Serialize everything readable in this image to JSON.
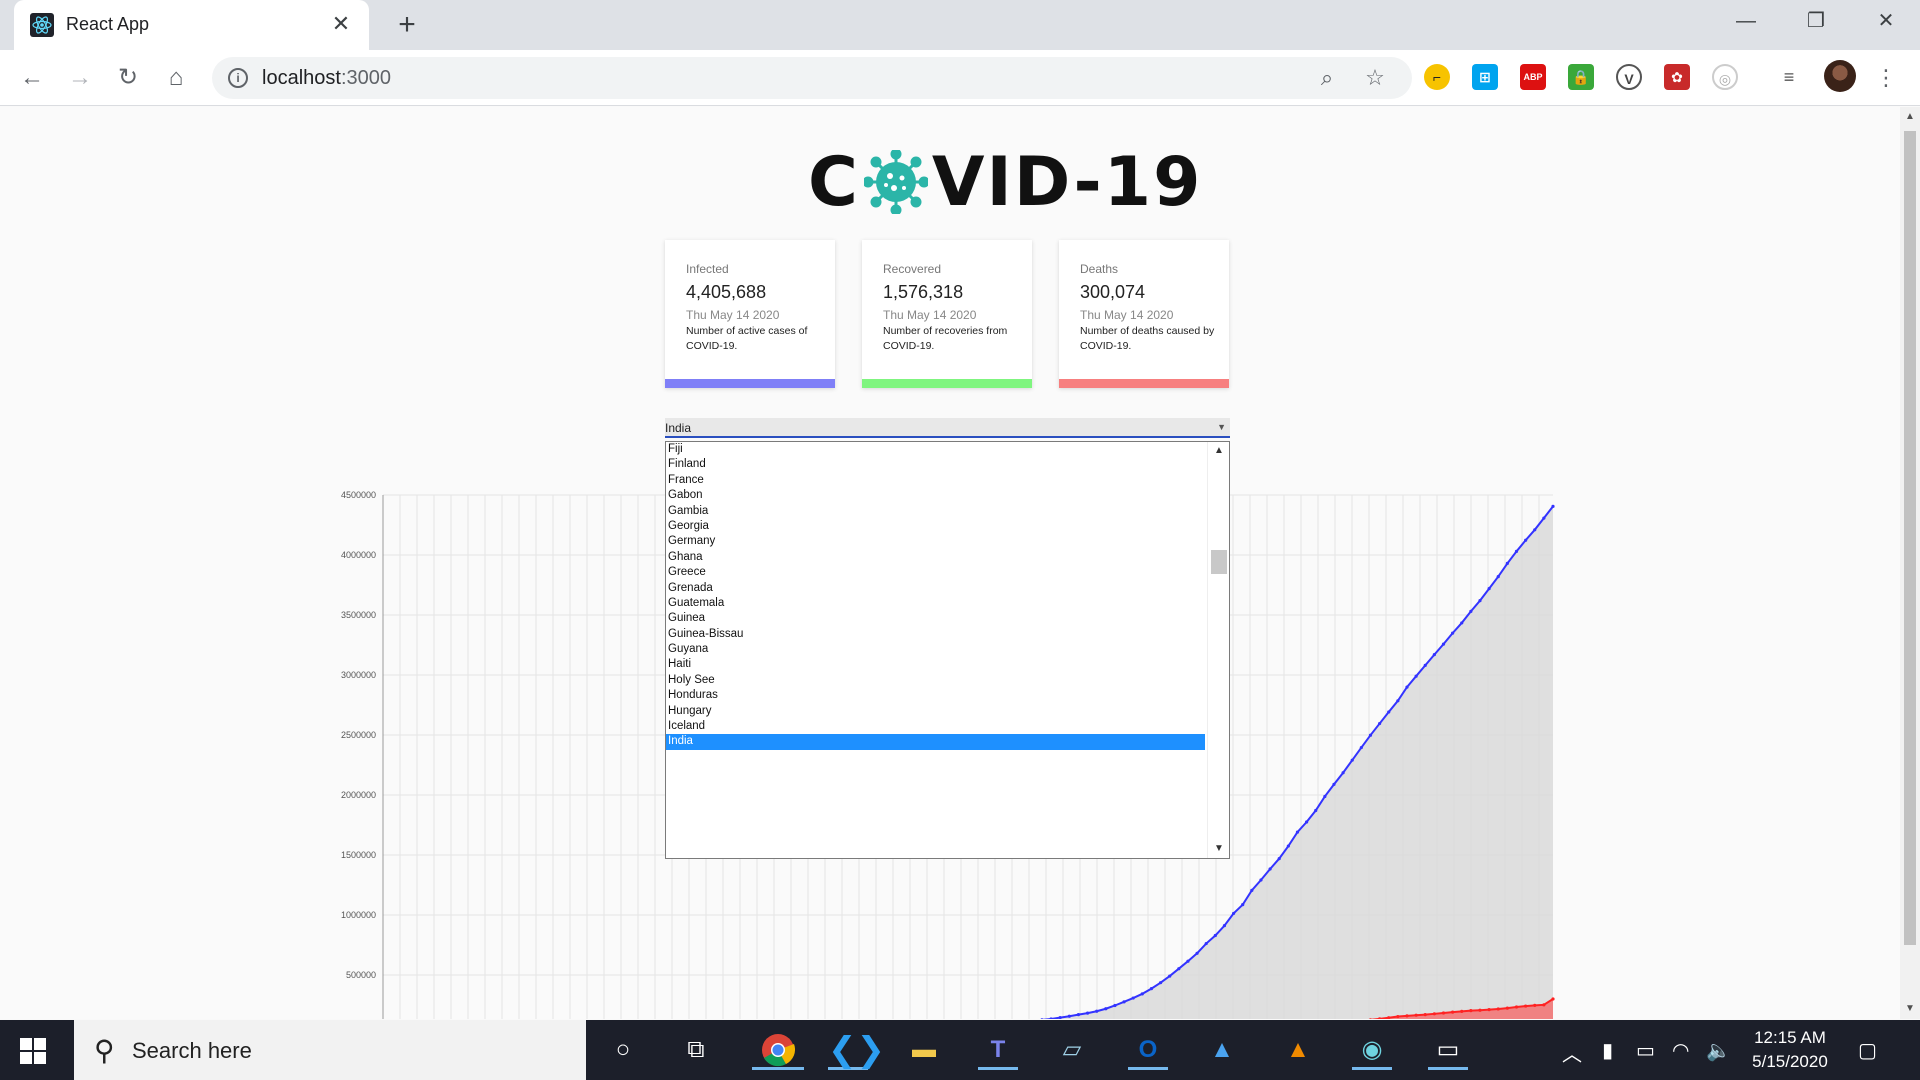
{
  "browser": {
    "tab_title": "React App",
    "url_host": "localhost",
    "url_port": ":3000",
    "tab_close": "✕",
    "new_tab": "+"
  },
  "page": {
    "logo_left": "C",
    "logo_right": "VID-19",
    "cards": [
      {
        "label": "Infected",
        "value": "4,405,688",
        "date": "Thu May 14 2020",
        "desc": "Number of active cases of COVID-19.",
        "color": "#7f7ff7"
      },
      {
        "label": "Recovered",
        "value": "1,576,318",
        "date": "Thu May 14 2020",
        "desc": "Number of recoveries from COVID-19.",
        "color": "#7ff57f"
      },
      {
        "label": "Deaths",
        "value": "300,074",
        "date": "Thu May 14 2020",
        "desc": "Number of deaths caused by COVID-19.",
        "color": "#f77f7f"
      }
    ],
    "country_select": {
      "value": "India",
      "options": [
        "Fiji",
        "Finland",
        "France",
        "Gabon",
        "Gambia",
        "Georgia",
        "Germany",
        "Ghana",
        "Greece",
        "Grenada",
        "Guatemala",
        "Guinea",
        "Guinea-Bissau",
        "Guyana",
        "Haiti",
        "Holy See",
        "Honduras",
        "Hungary",
        "Iceland",
        "India"
      ]
    }
  },
  "chart_data": {
    "type": "line",
    "ylim": [
      0,
      4500000
    ],
    "yticks": [
      "4500000",
      "4000000",
      "3500000",
      "3000000",
      "2500000",
      "2000000",
      "1500000",
      "1000000",
      "500000"
    ],
    "series": [
      {
        "color": "#3333ff",
        "fill": "#d9d9d9",
        "values": [
          555,
          653,
          941,
          1434,
          2118,
          2927,
          5578,
          6166,
          8234,
          9927,
          12038,
          16787,
          19881,
          23892,
          27635,
          30817,
          34391,
          37120,
          40150,
          42762,
          44802,
          45221,
          60368,
          66885,
          69030,
          71224,
          73258,
          75136,
          75639,
          76197,
          76819,
          78572,
          79570,
          81406,
          82725,
          84080,
          85934,
          88271,
          90812,
          92922,
          95100,
          97865,
          101736,
          105798,
          109758,
          113549,
          118525,
          125762,
          133290,
          145052,
          156484,
          169517,
          182437,
          198174,
          218825,
          245825,
          276562,
          307849,
          343018,
          386611,
          436016,
          491021,
          552578,
          614927,
          680735,
          762075,
          828980,
          911270,
          1013045,
          1086165,
          1205432,
          1291834,
          1383476,
          1470050,
          1574560,
          1690754,
          1775012,
          1870617,
          1988012,
          2088862,
          2185500,
          2290140,
          2395340,
          2498401,
          2595320,
          2692125,
          2785000,
          2899000,
          2990000,
          3080000,
          3170000,
          3257000,
          3349000,
          3434000,
          3530000,
          3620000,
          3720000,
          3820000,
          3930000,
          4030000,
          4123000,
          4210000,
          4307000,
          4405688
        ]
      },
      {
        "color": "#ff2222",
        "fill": "#f07c7c",
        "values": [
          17,
          18,
          26,
          42,
          56,
          82,
          131,
          133,
          171,
          213,
          259,
          362,
          426,
          492,
          564,
          634,
          719,
          806,
          906,
          1013,
          1113,
          1118,
          1371,
          1523,
          1666,
          1770,
          1868,
          2007,
          2122,
          2247,
          2251,
          2458,
          2469,
          2629,
          2708,
          2770,
          2814,
          2872,
          2941,
          2996,
          3085,
          3160,
          3254,
          3348,
          3460,
          3558,
          3803,
          3996,
          4262,
          4615,
          4720,
          5404,
          5819,
          6440,
          7126,
          7905,
          8733,
          9867,
          11299,
          12973,
          14651,
          16505,
          18625,
          21181,
          23970,
          27198,
          30652,
          33925,
          37582,
          42107,
          46809,
          52983,
          58787,
          64606,
          69374,
          74565,
          81865,
          88338,
          95455,
          102525,
          108503,
          114091,
          119482,
          126557,
          134179,
          143800,
          153822,
          159510,
          165044,
          169986,
          176583,
          183027,
          190858,
          197159,
          202849,
          206544,
          211167,
          217153,
          224172,
          233388,
          241079,
          246979,
          251537,
          300074
        ]
      }
    ]
  }
}
